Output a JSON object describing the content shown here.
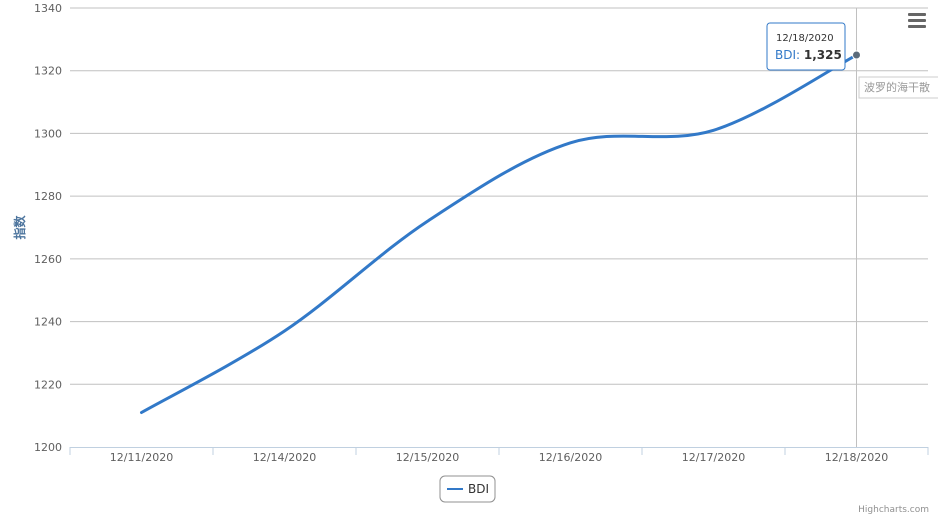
{
  "chart_data": {
    "type": "line",
    "categories": [
      "12/11/2020",
      "12/14/2020",
      "12/15/2020",
      "12/16/2020",
      "12/17/2020",
      "12/18/2020"
    ],
    "series": [
      {
        "name": "BDI",
        "values": [
          1211,
          1237,
          1272,
          1297,
          1301,
          1325
        ],
        "color": "#3279c8"
      }
    ],
    "ylabel": "指数",
    "ylim": [
      1200,
      1340
    ],
    "yticks": [
      1200,
      1220,
      1240,
      1260,
      1280,
      1300,
      1320,
      1340
    ],
    "grid": true,
    "legend_position": "bottom-center",
    "tooltip": {
      "date": "12/18/2020",
      "series": "BDI",
      "value": "1,325"
    },
    "side_label": "波罗的海干散",
    "credits": "Highcharts.com",
    "menu_icon": "hamburger-menu-icon"
  }
}
